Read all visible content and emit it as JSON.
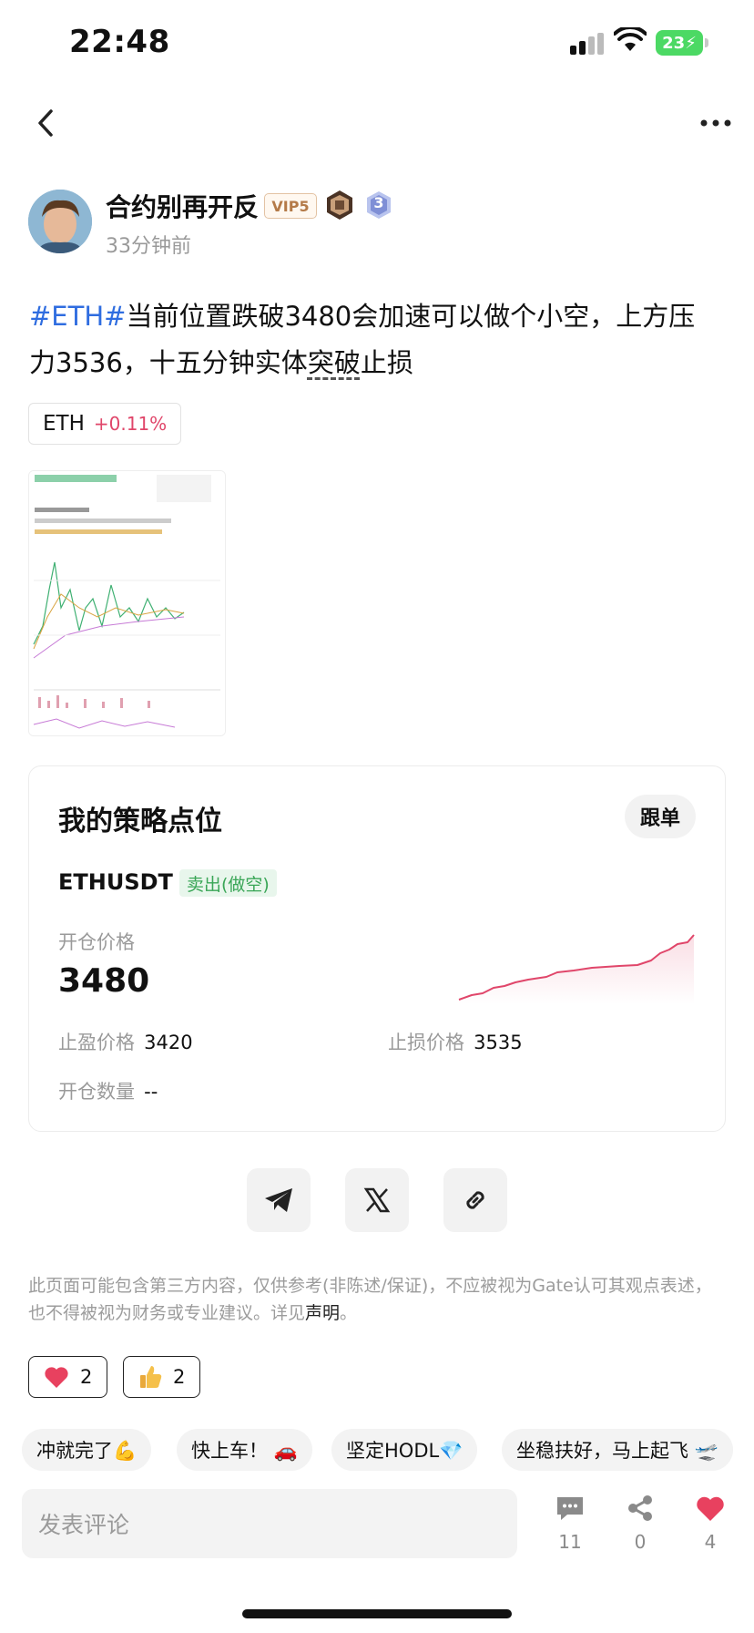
{
  "status_bar": {
    "time": "22:48",
    "battery": "23"
  },
  "author": {
    "name": "合约别再开反",
    "vip": "VIP5",
    "level": "3",
    "posted": "33分钟前"
  },
  "post": {
    "tag": "#ETH#",
    "text_a": "当前位置跌破3480会加速可以做个小空，上方压力3536，十五分钟实体",
    "text_ul": "突破",
    "text_b": "止损",
    "coin": "ETH",
    "coin_change": "+0.11%"
  },
  "strategy": {
    "title": "我的策略点位",
    "follow": "跟单",
    "pair": "ETHUSDT",
    "side": "卖出(做空)",
    "open_label": "开仓价格",
    "open_price": "3480",
    "tp_label": "止盈价格",
    "tp_value": "3420",
    "sl_label": "止损价格",
    "sl_value": "3535",
    "qty_label": "开仓数量",
    "qty_value": "--",
    "accent": "#e0466a"
  },
  "disclaimer": {
    "text": "此页面可能包含第三方内容，仅供参考(非陈述/保证)，不应被视为Gate认可其观点表述，也不得被视为财务或专业建议。详见",
    "link": "声明",
    "end": "。"
  },
  "reactions": [
    {
      "icon": "heart-icon",
      "count": "2"
    },
    {
      "icon": "thumbs-up-icon",
      "count": "2"
    }
  ],
  "quick_comments": [
    "冲就完了💪",
    "快上车！ 🚗",
    "坚定HODL💎",
    "坐稳扶好，马上起飞 🛫"
  ],
  "bottom": {
    "placeholder": "发表评论",
    "comments": "11",
    "shares": "0",
    "likes": "4"
  }
}
